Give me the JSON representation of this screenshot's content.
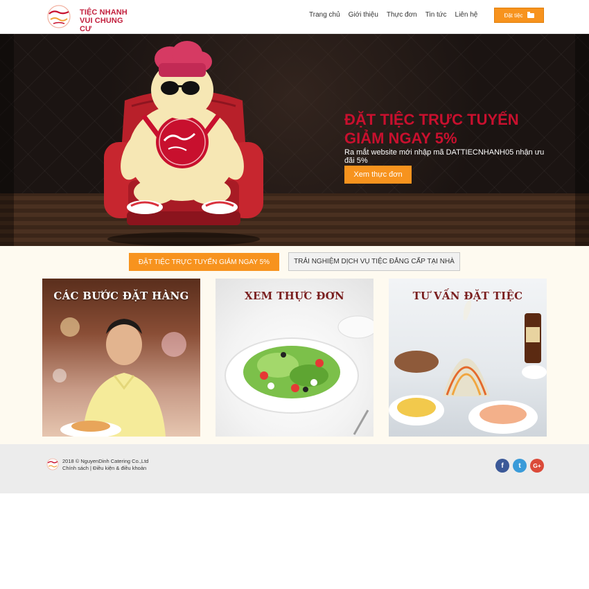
{
  "brand": {
    "logo_line1": "TIỆC NHANH",
    "logo_line2": "VUI CHUNG CƯ",
    "logo_mark_text": "Vui chung cư"
  },
  "nav": {
    "items": [
      "Trang chủ",
      "Giới thiệu",
      "Thực đơn",
      "Tin tức",
      "Liên hệ"
    ],
    "order_button": "Đặt tiệc",
    "order_icon": "folder-icon"
  },
  "hero": {
    "title": "ĐẶT TIỆC TRỰC TUYẾN GIẢM NGAY 5%",
    "subtitle": "Ra mắt website mới nhập mã DATTIECNHANH05 nhận ưu đãi 5%",
    "button": "Xem thực đơn"
  },
  "promo": {
    "tab_active": "ĐẶT TIỆC TRỰC TUYẾN GIẢM NGAY 5%",
    "tab_inactive": "TRẢI NGHIỆM DỊCH VỤ TIỆC ĐẲNG CẤP TẠI NHÀ"
  },
  "cards": [
    {
      "title": "CÁC BƯỚC ĐẶT HÀNG"
    },
    {
      "title": "XEM THỰC ĐƠN"
    },
    {
      "title": "TƯ VẤN ĐẶT TIỆC"
    }
  ],
  "footer": {
    "copyright": "2018 © NguyenDinh Catering Co.,Ltd",
    "links": "Chính sách | Điều kiện & điều khoản",
    "social": [
      {
        "icon": "facebook-icon",
        "glyph": "f",
        "color": "#3b5998"
      },
      {
        "icon": "twitter-icon",
        "glyph": "t",
        "color": "#3a9bd9"
      },
      {
        "icon": "google-plus-icon",
        "glyph": "G+",
        "color": "#db4a39"
      }
    ]
  },
  "colors": {
    "accent": "#f7931e",
    "brand_red": "#c8102e"
  }
}
